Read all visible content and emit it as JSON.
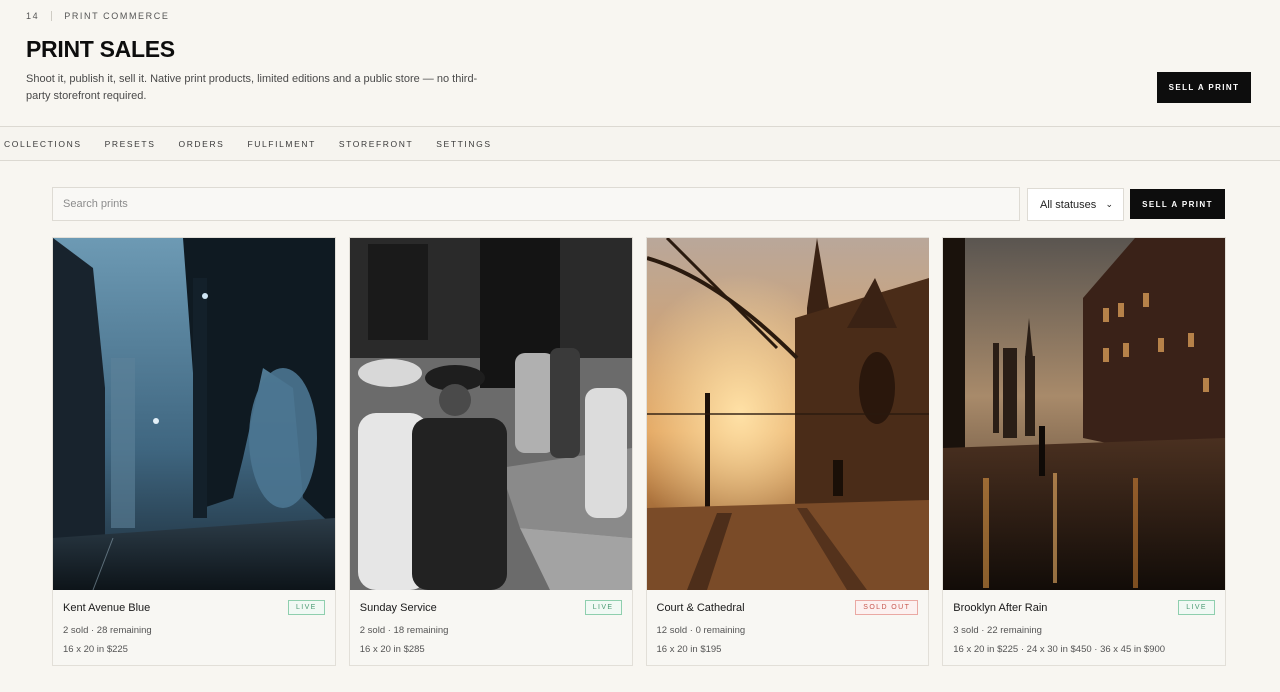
{
  "header": {
    "count": "14",
    "section": "PRINT COMMERCE",
    "title": "PRINT SALES",
    "description": "Shoot it, publish it, sell it. Native print products, limited editions and a public store — no third-party storefront required.",
    "cta_label": "SELL A PRINT"
  },
  "nav": {
    "items": [
      "COLLECTIONS",
      "PRESETS",
      "ORDERS",
      "FULFILMENT",
      "STOREFRONT",
      "SETTINGS"
    ]
  },
  "toolbar": {
    "search_placeholder": "Search prints",
    "status_filter": "All statuses",
    "cta_label": "SELL A PRINT"
  },
  "colors": {
    "live": "#4a9a72",
    "sold_out": "#c7584f",
    "accent": "#0d0d0d"
  },
  "prints": [
    {
      "title": "Kent Avenue Blue",
      "status": "LIVE",
      "meta": "2 sold · 28 remaining",
      "prices": "16 x 20 in $225"
    },
    {
      "title": "Sunday Service",
      "status": "LIVE",
      "meta": "2 sold · 18 remaining",
      "prices": "16 x 20 in $285"
    },
    {
      "title": "Court & Cathedral",
      "status": "SOLD OUT",
      "meta": "12 sold · 0 remaining",
      "prices": "16 x 20 in $195"
    },
    {
      "title": "Brooklyn After Rain",
      "status": "LIVE",
      "meta": "3 sold · 22 remaining",
      "prices": "16 x 20 in $225 · 24 x 30 in $450 · 36 x 45 in $900"
    }
  ]
}
